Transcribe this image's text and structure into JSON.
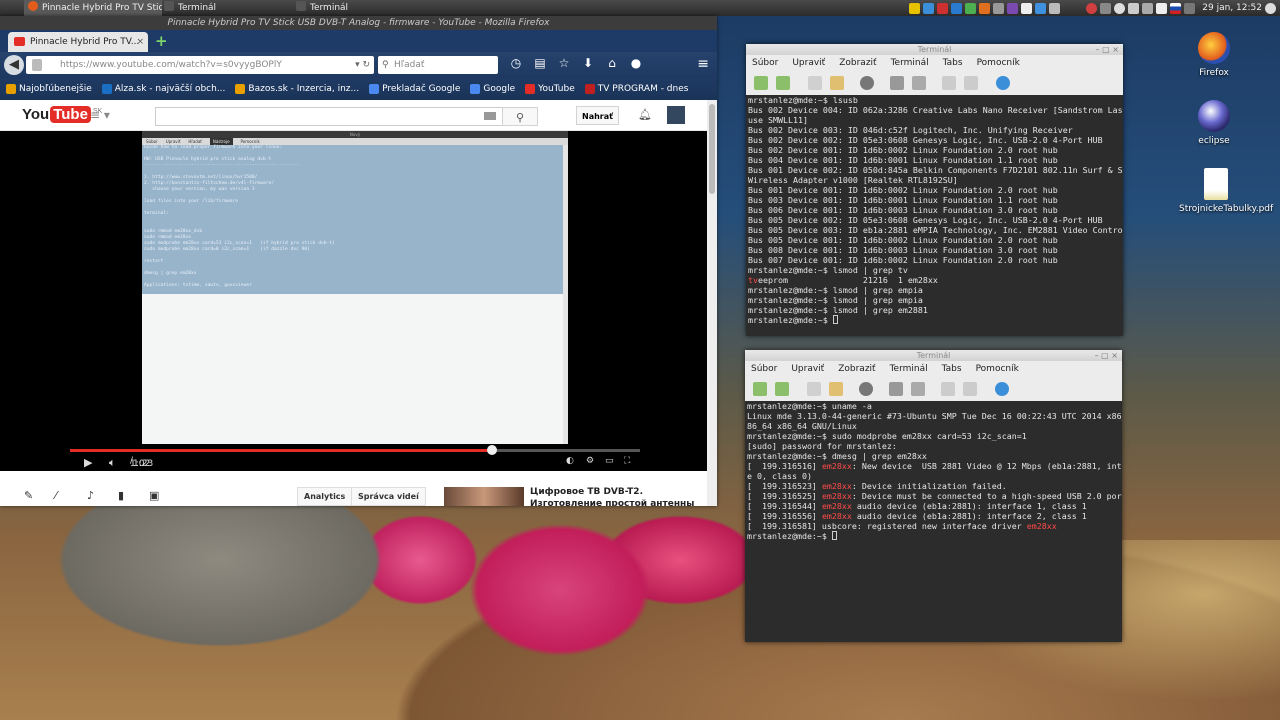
{
  "taskbar": {
    "tasks": [
      {
        "label": "Pinnacle Hybrid Pro TV Stic...",
        "active": true
      },
      {
        "label": "Terminál",
        "active": false
      },
      {
        "label": "Terminál",
        "active": false
      }
    ],
    "clock": "29 jan, 12:52"
  },
  "desktop": {
    "icons": [
      {
        "label": "Firefox"
      },
      {
        "label": "eclipse"
      },
      {
        "label": "StrojnickeTabulky.pdf"
      }
    ]
  },
  "firefox": {
    "window_title": "Pinnacle Hybrid Pro TV Stick USB DVB-T Analog - firmware - YouTube - Mozilla Firefox",
    "tab_label": "Pinnacle Hybrid Pro TV...",
    "url": "https://www.youtube.com/watch?v=s0vyygBOPlY",
    "search_placeholder": "Hľadať",
    "bookmarks": [
      {
        "label": "Najobľúbenejšie",
        "color": "#e8a000"
      },
      {
        "label": "Alza.sk - najväčší obch...",
        "color": "#1a6fc4"
      },
      {
        "label": "Bazos.sk - Inzercia, inz...",
        "color": "#e8a000"
      },
      {
        "label": "Prekladač Google",
        "color": "#4a8af0"
      },
      {
        "label": "Google",
        "color": "#4a8af0"
      },
      {
        "label": "YouTube",
        "color": "#e52d27"
      },
      {
        "label": "TV PROGRAM - dnes",
        "color": "#c02020"
      }
    ]
  },
  "youtube": {
    "logo_you": "You",
    "logo_tube": "Tube",
    "logo_country": "SK",
    "upload_label": "Nahrať",
    "video": {
      "inner_title": "Nový",
      "inner_menu": [
        "Súbor",
        "Upraviť",
        "Hľadať",
        "Nástroje",
        "Pomocník"
      ],
      "lines": [
        "Guide how to load proper firmware into your linux:",
        "",
        "HW: USB Pinnacle hybrid pro stick analog dvb-t",
        "--------------------------------------------------------",
        "",
        "1. http://www.stevoxtm.net/linux/hvr1500/",
        "2. http://konstantin-filtschew.de/v4l-firmware/",
        "   choose your version, my was version 3",
        "",
        "load files into your /lib/firmware",
        "",
        "terminal:",
        "",
        "",
        "sudo rmmod em28xx_dvb",
        "sudo rmmod em28xx",
        "sudo modprobe em28xx card=53 i2c_scan=1   (if hybrid pro stick dvb-t)",
        "sudo modprobe em28xx card=0 i2c_scan=1    (if dazzle dvc 90)",
        "",
        "restart",
        "",
        "dmesg | grep em28xx",
        "",
        "Applications: tvtime, xawtv, guvcviewer"
      ],
      "time_current": "1:02",
      "time_total": "1:23",
      "progress": 0.74
    },
    "below_buttons": {
      "analytics": "Analytics",
      "manage": "Správca videí"
    },
    "recommended_title": "Цифровое ТВ DVB-T2. Изготовление простой антенны"
  },
  "terminal1": {
    "title": "Terminál",
    "menu": [
      "Súbor",
      "Upraviť",
      "Zobraziť",
      "Terminál",
      "Tabs",
      "Pomocník"
    ],
    "lines": [
      "mrstanlez@mde:~$ lsusb",
      "Bus 002 Device 004: ID 062a:3286 Creative Labs Nano Receiver [Sandstrom Laser Mo",
      "use SMWLL11]",
      "Bus 002 Device 003: ID 046d:c52f Logitech, Inc. Unifying Receiver",
      "Bus 002 Device 002: ID 05e3:0608 Genesys Logic, Inc. USB-2.0 4-Port HUB",
      "Bus 002 Device 001: ID 1d6b:0002 Linux Foundation 2.0 root hub",
      "Bus 004 Device 001: ID 1d6b:0001 Linux Foundation 1.1 root hub",
      "Bus 001 Device 002: ID 050d:845a Belkin Components F7D2101 802.11n Surf & Share",
      "Wireless Adapter v1000 [Realtek RTL8192SU]",
      "Bus 001 Device 001: ID 1d6b:0002 Linux Foundation 2.0 root hub",
      "Bus 003 Device 001: ID 1d6b:0001 Linux Foundation 1.1 root hub",
      "Bus 006 Device 001: ID 1d6b:0003 Linux Foundation 3.0 root hub",
      "Bus 005 Device 002: ID 05e3:0608 Genesys Logic, Inc. USB-2.0 4-Port HUB",
      "Bus 005 Device 003: ID eb1a:2881 eMPIA Technology, Inc. EM2881 Video Controller",
      "Bus 005 Device 001: ID 1d6b:0002 Linux Foundation 2.0 root hub",
      "Bus 008 Device 001: ID 1d6b:0003 Linux Foundation 3.0 root hub",
      "Bus 007 Device 001: ID 1d6b:0002 Linux Foundation 2.0 root hub",
      "mrstanlez@mde:~$ lsmod | grep tv",
      "tveeprom               21216  1 em28xx",
      "mrstanlez@mde:~$ lsmod | grep empia",
      "mrstanlez@mde:~$ lsmod | grep empia",
      "mrstanlez@mde:~$ lsmod | grep em2881",
      "mrstanlez@mde:~$ "
    ]
  },
  "terminal2": {
    "title": "Terminál",
    "menu": [
      "Súbor",
      "Upraviť",
      "Zobraziť",
      "Terminál",
      "Tabs",
      "Pomocník"
    ],
    "lines": [
      "mrstanlez@mde:~$ uname -a",
      "Linux mde 3.13.0-44-generic #73-Ubuntu SMP Tue Dec 16 00:22:43 UTC 2014 x86_64 x",
      "86_64 x86_64 GNU/Linux",
      "mrstanlez@mde:~$ sudo modprobe em28xx card=53 i2c_scan=1",
      "[sudo] password for mrstanlez:",
      "mrstanlez@mde:~$ dmesg | grep em28xx",
      "[  199.316516] em28xx: New device  USB 2881 Video @ 12 Mbps (eb1a:2881, interfac",
      "e 0, class 0)",
      "[  199.316523] em28xx: Device initialization failed.",
      "[  199.316525] em28xx: Device must be connected to a high-speed USB 2.0 port.",
      "[  199.316544] em28xx audio device (eb1a:2881): interface 1, class 1",
      "[  199.316556] em28xx audio device (eb1a:2881): interface 2, class 1",
      "[  199.316581] usbcore: registered new interface driver em28xx",
      "mrstanlez@mde:~$ "
    ]
  }
}
